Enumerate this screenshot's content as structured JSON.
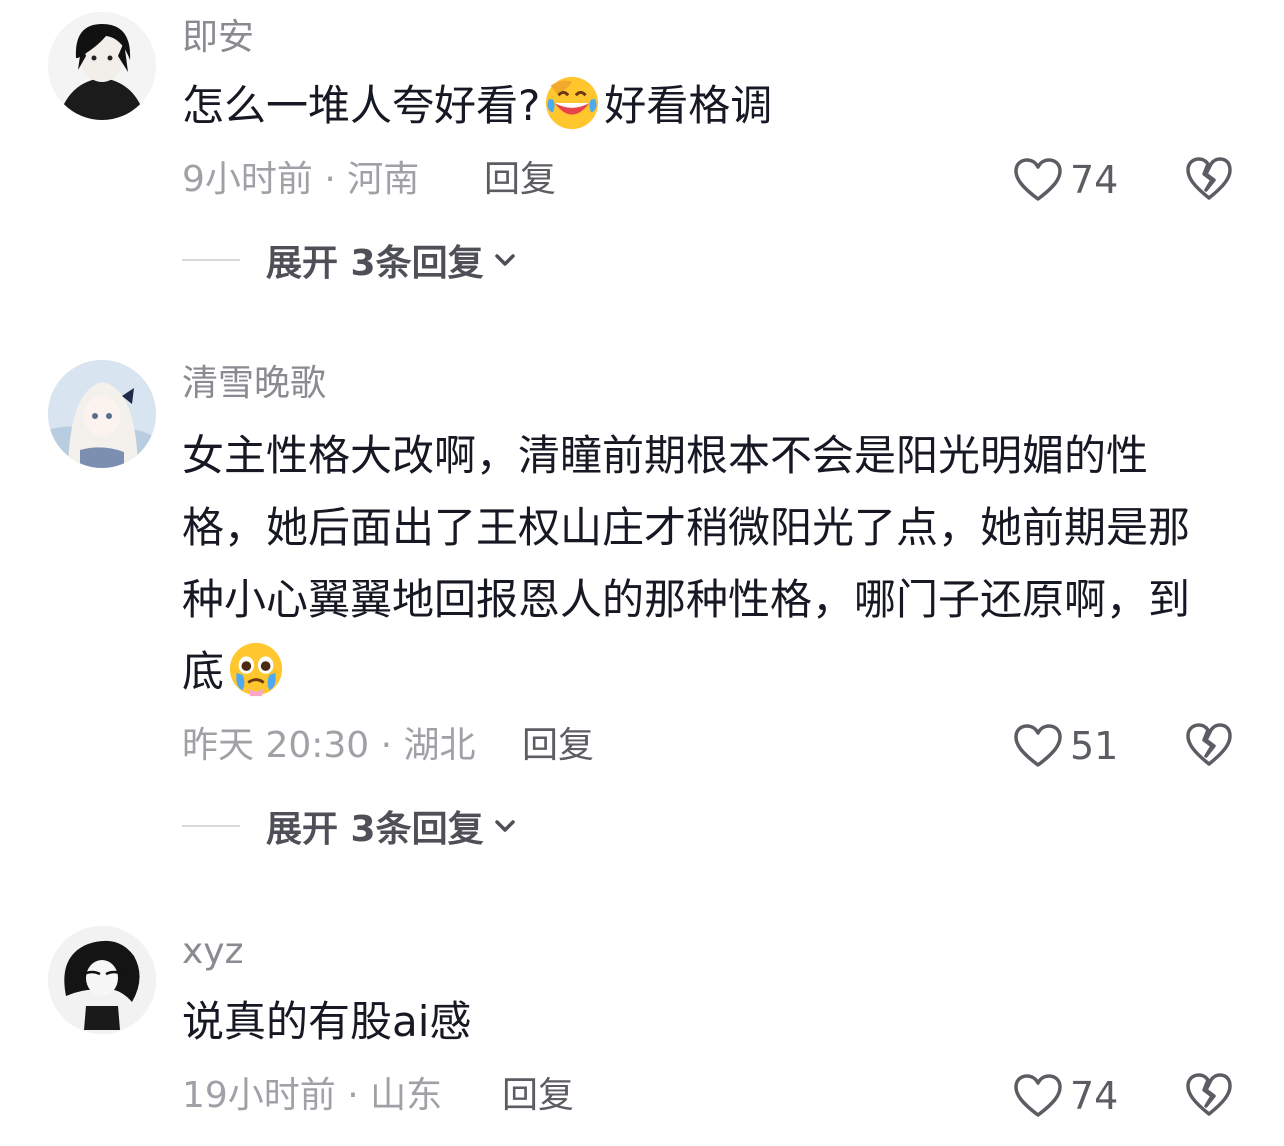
{
  "comments": [
    {
      "username": "即安",
      "text_before": "怎么一堆人夸好看?",
      "emoji": "laughing-tears-emoji",
      "text_after": "好看格调",
      "meta": "9小时前 · 河南",
      "reply_label": "回复",
      "likes": "74",
      "expand_label": "展开 3条回复"
    },
    {
      "username": "清雪晚歌",
      "text_before": "女主性格大改啊，清瞳前期根本不会是阳光明媚的性格，她后面出了王权山庄才稍微阳光了点，她前期是那种小心翼翼地回报恩人的那种性格，哪门子还原啊，到底",
      "emoji": "pleading-tears-emoji",
      "text_after": "",
      "meta": "昨天 20:30 · 湖北",
      "reply_label": "回复",
      "likes": "51",
      "expand_label": "展开 3条回复"
    },
    {
      "username": "xyz",
      "text_before": "说真的有股ai感",
      "emoji": "",
      "text_after": "",
      "meta": "19小时前 · 山东",
      "reply_label": "回复",
      "likes": "74",
      "expand_label": ""
    }
  ],
  "colors": {
    "text_primary": "#161823",
    "text_secondary": "#8a8b91",
    "meta": "#a0a1a6",
    "icon_stroke": "#5c5d63"
  }
}
